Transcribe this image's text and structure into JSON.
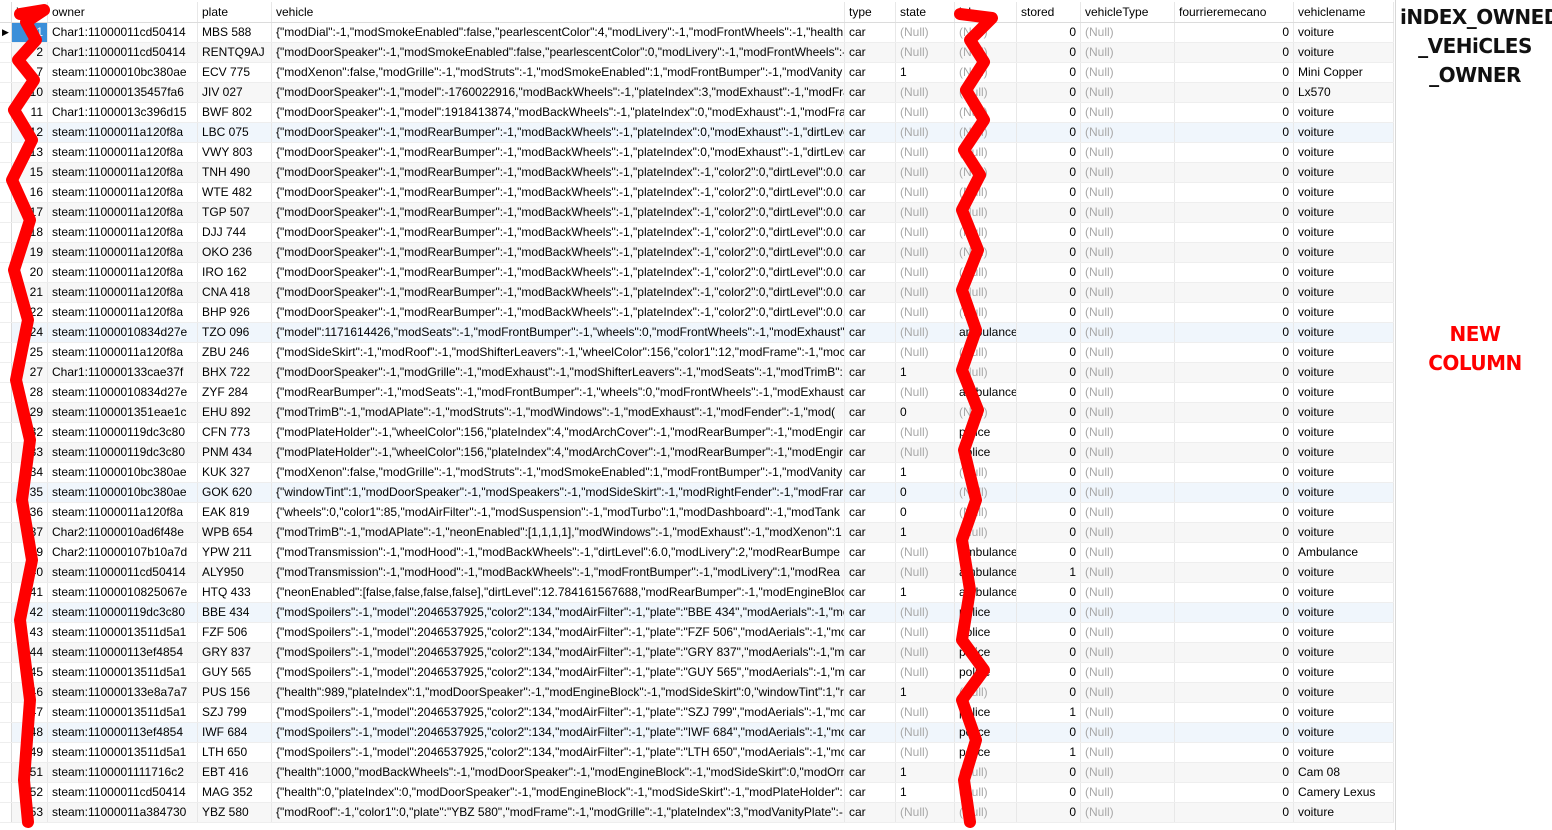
{
  "columns": [
    "id",
    "owner",
    "plate",
    "vehicle",
    "type",
    "state",
    "job",
    "stored",
    "vehicleType",
    "fourrieremecano",
    "vehiclename"
  ],
  "annotations": {
    "title_lines": [
      "iNDEX_OWNED",
      "_VEHiCLES",
      "_OWNER"
    ],
    "new_column": "NEW COLUMN"
  },
  "colors": {
    "accent": "#3b8fd9",
    "scribble": "#ff0000"
  },
  "selected_row_id": "1",
  "rows": [
    [
      "1",
      "Char1:11000011cd50414",
      "MBS 588",
      "{\"modDial\":-1,\"modSmokeEnabled\":false,\"pearlescentColor\":4,\"modLivery\":-1,\"modFrontWheels\":-1,\"health",
      "car",
      "(Null)",
      "(Null)",
      "0",
      "(Null)",
      "0",
      "voiture"
    ],
    [
      "2",
      "Char1:11000011cd50414",
      "RENTQ9AJ",
      "{\"modDoorSpeaker\":-1,\"modSmokeEnabled\":false,\"pearlescentColor\":0,\"modLivery\":-1,\"modFrontWheels\":-",
      "car",
      "(Null)",
      "(Null)",
      "0",
      "(Null)",
      "0",
      "voiture"
    ],
    [
      "7",
      "steam:11000010bc380ae",
      "ECV 775",
      "{\"modXenon\":false,\"modGrille\":-1,\"modStruts\":-1,\"modSmokeEnabled\":1,\"modFrontBumper\":-1,\"modVanity",
      "car",
      "1",
      "(Null)",
      "0",
      "(Null)",
      "0",
      "Mini Copper"
    ],
    [
      "10",
      "steam:110000135457fa6",
      "JIV 027",
      "{\"modDoorSpeaker\":-1,\"model\":-1760022916,\"modBackWheels\":-1,\"plateIndex\":3,\"modExhaust\":-1,\"modFrar",
      "car",
      "(Null)",
      "(Null)",
      "0",
      "(Null)",
      "0",
      "Lx570"
    ],
    [
      "11",
      "Char1:11000013c396d15",
      "BWF 802",
      "{\"modDoorSpeaker\":-1,\"model\":1918413874,\"modBackWheels\":-1,\"plateIndex\":0,\"modExhaust\":-1,\"modFram",
      "car",
      "(Null)",
      "(Null)",
      "0",
      "(Null)",
      "0",
      "voiture"
    ],
    [
      "12",
      "steam:11000011a120f8a",
      "LBC 075",
      "{\"modDoorSpeaker\":-1,\"modRearBumper\":-1,\"modBackWheels\":-1,\"plateIndex\":0,\"modExhaust\":-1,\"dirtLeve",
      "car",
      "(Null)",
      "(Null)",
      "0",
      "(Null)",
      "0",
      "voiture"
    ],
    [
      "13",
      "steam:11000011a120f8a",
      "VWY 803",
      "{\"modDoorSpeaker\":-1,\"modRearBumper\":-1,\"modBackWheels\":-1,\"plateIndex\":0,\"modExhaust\":-1,\"dirtLeve",
      "car",
      "(Null)",
      "(Null)",
      "0",
      "(Null)",
      "0",
      "voiture"
    ],
    [
      "15",
      "steam:11000011a120f8a",
      "TNH 490",
      "{\"modDoorSpeaker\":-1,\"modRearBumper\":-1,\"modBackWheels\":-1,\"plateIndex\":-1,\"color2\":0,\"dirtLevel\":0.0,'",
      "car",
      "(Null)",
      "(Null)",
      "0",
      "(Null)",
      "0",
      "voiture"
    ],
    [
      "16",
      "steam:11000011a120f8a",
      "WTE 482",
      "{\"modDoorSpeaker\":-1,\"modRearBumper\":-1,\"modBackWheels\":-1,\"plateIndex\":-1,\"color2\":0,\"dirtLevel\":0.0,'",
      "car",
      "(Null)",
      "(Null)",
      "0",
      "(Null)",
      "0",
      "voiture"
    ],
    [
      "17",
      "steam:11000011a120f8a",
      "TGP 507",
      "{\"modDoorSpeaker\":-1,\"modRearBumper\":-1,\"modBackWheels\":-1,\"plateIndex\":-1,\"color2\":0,\"dirtLevel\":0.0,'",
      "car",
      "(Null)",
      "(Null)",
      "0",
      "(Null)",
      "0",
      "voiture"
    ],
    [
      "18",
      "steam:11000011a120f8a",
      "DJJ 744",
      "{\"modDoorSpeaker\":-1,\"modRearBumper\":-1,\"modBackWheels\":-1,\"plateIndex\":-1,\"color2\":0,\"dirtLevel\":0.0,'",
      "car",
      "(Null)",
      "(Null)",
      "0",
      "(Null)",
      "0",
      "voiture"
    ],
    [
      "19",
      "steam:11000011a120f8a",
      "OKO 236",
      "{\"modDoorSpeaker\":-1,\"modRearBumper\":-1,\"modBackWheels\":-1,\"plateIndex\":-1,\"color2\":0,\"dirtLevel\":0.0,'",
      "car",
      "(Null)",
      "(Null)",
      "0",
      "(Null)",
      "0",
      "voiture"
    ],
    [
      "20",
      "steam:11000011a120f8a",
      "IRO 162",
      "{\"modDoorSpeaker\":-1,\"modRearBumper\":-1,\"modBackWheels\":-1,\"plateIndex\":-1,\"color2\":0,\"dirtLevel\":0.0,'",
      "car",
      "(Null)",
      "(Null)",
      "0",
      "(Null)",
      "0",
      "voiture"
    ],
    [
      "21",
      "steam:11000011a120f8a",
      "CNA 418",
      "{\"modDoorSpeaker\":-1,\"modRearBumper\":-1,\"modBackWheels\":-1,\"plateIndex\":-1,\"color2\":0,\"dirtLevel\":0.0,'",
      "car",
      "(Null)",
      "(Null)",
      "0",
      "(Null)",
      "0",
      "voiture"
    ],
    [
      "22",
      "steam:11000011a120f8a",
      "BHP 926",
      "{\"modDoorSpeaker\":-1,\"modRearBumper\":-1,\"modBackWheels\":-1,\"plateIndex\":-1,\"color2\":0,\"dirtLevel\":0.0,'",
      "car",
      "(Null)",
      "(Null)",
      "0",
      "(Null)",
      "0",
      "voiture"
    ],
    [
      "24",
      "steam:11000010834d27e",
      "TZO 096",
      "{\"model\":1171614426,\"modSeats\":-1,\"modFrontBumper\":-1,\"wheels\":0,\"modFrontWheels\":-1,\"modExhaust\":",
      "car",
      "(Null)",
      "ambulance",
      "0",
      "(Null)",
      "0",
      "voiture"
    ],
    [
      "25",
      "steam:11000011a120f8a",
      "ZBU 246",
      "{\"modSideSkirt\":-1,\"modRoof\":-1,\"modShifterLeavers\":-1,\"wheelColor\":156,\"color1\":12,\"modFrame\":-1,\"moc",
      "car",
      "(Null)",
      "(Null)",
      "0",
      "(Null)",
      "0",
      "voiture"
    ],
    [
      "27",
      "Char1:110000133cae37f",
      "BHX 722",
      "{\"modDoorSpeaker\":-1,\"modGrille\":-1,\"modExhaust\":-1,\"modShifterLeavers\":-1,\"modSeats\":-1,\"modTrimB\":",
      "car",
      "1",
      "(Null)",
      "0",
      "(Null)",
      "0",
      "voiture"
    ],
    [
      "28",
      "steam:11000010834d27e",
      "ZYF 284",
      "{\"modRearBumper\":-1,\"modSeats\":-1,\"modFrontBumper\":-1,\"wheels\":0,\"modFrontWheels\":-1,\"modExhaust'",
      "car",
      "(Null)",
      "ambulance",
      "0",
      "(Null)",
      "0",
      "voiture"
    ],
    [
      "29",
      "steam:1100001351eae1c",
      "EHU 892",
      "{\"modTrimB\":-1,\"modAPlate\":-1,\"modStruts\":-1,\"modWindows\":-1,\"modExhaust\":-1,\"modFender\":-1,\"mod(",
      "car",
      "0",
      "(Null)",
      "0",
      "(Null)",
      "0",
      "voiture"
    ],
    [
      "32",
      "steam:110000119dc3c80",
      "CFN 773",
      "{\"modPlateHolder\":-1,\"wheelColor\":156,\"plateIndex\":4,\"modArchCover\":-1,\"modRearBumper\":-1,\"modEngir",
      "car",
      "(Null)",
      "police",
      "0",
      "(Null)",
      "0",
      "voiture"
    ],
    [
      "33",
      "steam:110000119dc3c80",
      "PNM 434",
      "{\"modPlateHolder\":-1,\"wheelColor\":156,\"plateIndex\":4,\"modArchCover\":-1,\"modRearBumper\":-1,\"modEngir",
      "car",
      "(Null)",
      "police",
      "0",
      "(Null)",
      "0",
      "voiture"
    ],
    [
      "34",
      "steam:11000010bc380ae",
      "KUK 327",
      "{\"modXenon\":false,\"modGrille\":-1,\"modStruts\":-1,\"modSmokeEnabled\":1,\"modFrontBumper\":-1,\"modVanity",
      "car",
      "1",
      "(Null)",
      "0",
      "(Null)",
      "0",
      "voiture"
    ],
    [
      "35",
      "steam:11000010bc380ae",
      "GOK 620",
      "{\"windowTint\":1,\"modDoorSpeaker\":-1,\"modSpeakers\":-1,\"modSideSkirt\":-1,\"modRightFender\":-1,\"modFrar",
      "car",
      "0",
      "(Null)",
      "0",
      "(Null)",
      "0",
      "voiture"
    ],
    [
      "36",
      "steam:11000011a120f8a",
      "EAK 819",
      "{\"wheels\":0,\"color1\":85,\"modAirFilter\":-1,\"modSuspension\":-1,\"modTurbo\":1,\"modDashboard\":-1,\"modTank",
      "car",
      "0",
      "(Null)",
      "0",
      "(Null)",
      "0",
      "voiture"
    ],
    [
      "37",
      "Char2:11000010ad6f48e",
      "WPB 654",
      "{\"modTrimB\":-1,\"modAPlate\":-1,\"neonEnabled\":[1,1,1,1],\"modWindows\":-1,\"modExhaust\":-1,\"modXenon\":1",
      "car",
      "1",
      "(Null)",
      "0",
      "(Null)",
      "0",
      "voiture"
    ],
    [
      "39",
      "Char2:110000107b10a7d",
      "YPW 211",
      "{\"modTransmission\":-1,\"modHood\":-1,\"modBackWheels\":-1,\"dirtLevel\":6.0,\"modLivery\":2,\"modRearBumpe",
      "car",
      "(Null)",
      "ambulance",
      "0",
      "(Null)",
      "0",
      "Ambulance"
    ],
    [
      "40",
      "steam:11000011cd50414",
      "ALY950",
      "{\"modTransmission\":-1,\"modHood\":-1,\"modBackWheels\":-1,\"modFrontBumper\":-1,\"modLivery\":1,\"modRea",
      "car",
      "(Null)",
      "ambulance",
      "1",
      "(Null)",
      "0",
      "voiture"
    ],
    [
      "41",
      "steam:11000010825067e",
      "HTQ 433",
      "{\"neonEnabled\":[false,false,false,false],\"dirtLevel\":12.784161567688,\"modRearBumper\":-1,\"modEngineBlock\":",
      "car",
      "1",
      "ambulance",
      "0",
      "(Null)",
      "0",
      "voiture"
    ],
    [
      "42",
      "steam:110000119dc3c80",
      "BBE 434",
      "{\"modSpoilers\":-1,\"model\":2046537925,\"color2\":134,\"modAirFilter\":-1,\"plate\":\"BBE 434\",\"modAerials\":-1,\"mo",
      "car",
      "(Null)",
      "police",
      "0",
      "(Null)",
      "0",
      "voiture"
    ],
    [
      "43",
      "steam:11000013511d5a1",
      "FZF 506",
      "{\"modSpoilers\":-1,\"model\":2046537925,\"color2\":134,\"modAirFilter\":-1,\"plate\":\"FZF 506\",\"modAerials\":-1,\"mo",
      "car",
      "(Null)",
      "police",
      "0",
      "(Null)",
      "0",
      "voiture"
    ],
    [
      "44",
      "steam:110000113ef4854",
      "GRY 837",
      "{\"modSpoilers\":-1,\"model\":2046537925,\"color2\":134,\"modAirFilter\":-1,\"plate\":\"GRY 837\",\"modAerials\":-1,\"mc",
      "car",
      "(Null)",
      "police",
      "0",
      "(Null)",
      "0",
      "voiture"
    ],
    [
      "45",
      "steam:11000013511d5a1",
      "GUY 565",
      "{\"modSpoilers\":-1,\"model\":2046537925,\"color2\":134,\"modAirFilter\":-1,\"plate\":\"GUY 565\",\"modAerials\":-1,\"mc",
      "car",
      "(Null)",
      "police",
      "0",
      "(Null)",
      "0",
      "voiture"
    ],
    [
      "46",
      "steam:110000133e8a7a7",
      "PUS 156",
      "{\"health\":989,\"plateIndex\":1,\"modDoorSpeaker\":-1,\"modEngineBlock\":-1,\"modSideSkirt\":0,\"windowTint\":1,\"r",
      "car",
      "1",
      "(Null)",
      "0",
      "(Null)",
      "0",
      "voiture"
    ],
    [
      "47",
      "steam:11000013511d5a1",
      "SZJ 799",
      "{\"modSpoilers\":-1,\"model\":2046537925,\"color2\":134,\"modAirFilter\":-1,\"plate\":\"SZJ 799\",\"modAerials\":-1,\"moc",
      "car",
      "(Null)",
      "police",
      "1",
      "(Null)",
      "0",
      "voiture"
    ],
    [
      "48",
      "steam:110000113ef4854",
      "IWF 684",
      "{\"modSpoilers\":-1,\"model\":2046537925,\"color2\":134,\"modAirFilter\":-1,\"plate\":\"IWF 684\",\"modAerials\":-1,\"mo",
      "car",
      "(Null)",
      "police",
      "0",
      "(Null)",
      "0",
      "voiture"
    ],
    [
      "49",
      "steam:11000013511d5a1",
      "LTH 650",
      "{\"modSpoilers\":-1,\"model\":2046537925,\"color2\":134,\"modAirFilter\":-1,\"plate\":\"LTH 650\",\"modAerials\":-1,\"mc",
      "car",
      "(Null)",
      "police",
      "1",
      "(Null)",
      "0",
      "voiture"
    ],
    [
      "51",
      "steam:1100001111716c2",
      "EBT 416",
      "{\"health\":1000,\"modBackWheels\":-1,\"modDoorSpeaker\":-1,\"modEngineBlock\":-1,\"modSideSkirt\":0,\"modOrn",
      "car",
      "1",
      "(Null)",
      "0",
      "(Null)",
      "0",
      "Cam 08"
    ],
    [
      "52",
      "steam:11000011cd50414",
      "MAG 352",
      "{\"health\":0,\"plateIndex\":0,\"modDoorSpeaker\":-1,\"modEngineBlock\":-1,\"modSideSkirt\":-1,\"modPlateHolder\":",
      "car",
      "1",
      "(Null)",
      "0",
      "(Null)",
      "0",
      "Camery Lexus"
    ],
    [
      "53",
      "steam:11000011a384730",
      "YBZ 580",
      "{\"modRoof\":-1,\"color1\":0,\"plate\":\"YBZ 580\",\"modFrame\":-1,\"modGrille\":-1,\"plateIndex\":3,\"modVanityPlate\":-",
      "car",
      "(Null)",
      "(Null)",
      "0",
      "(Null)",
      "0",
      "voiture"
    ]
  ]
}
